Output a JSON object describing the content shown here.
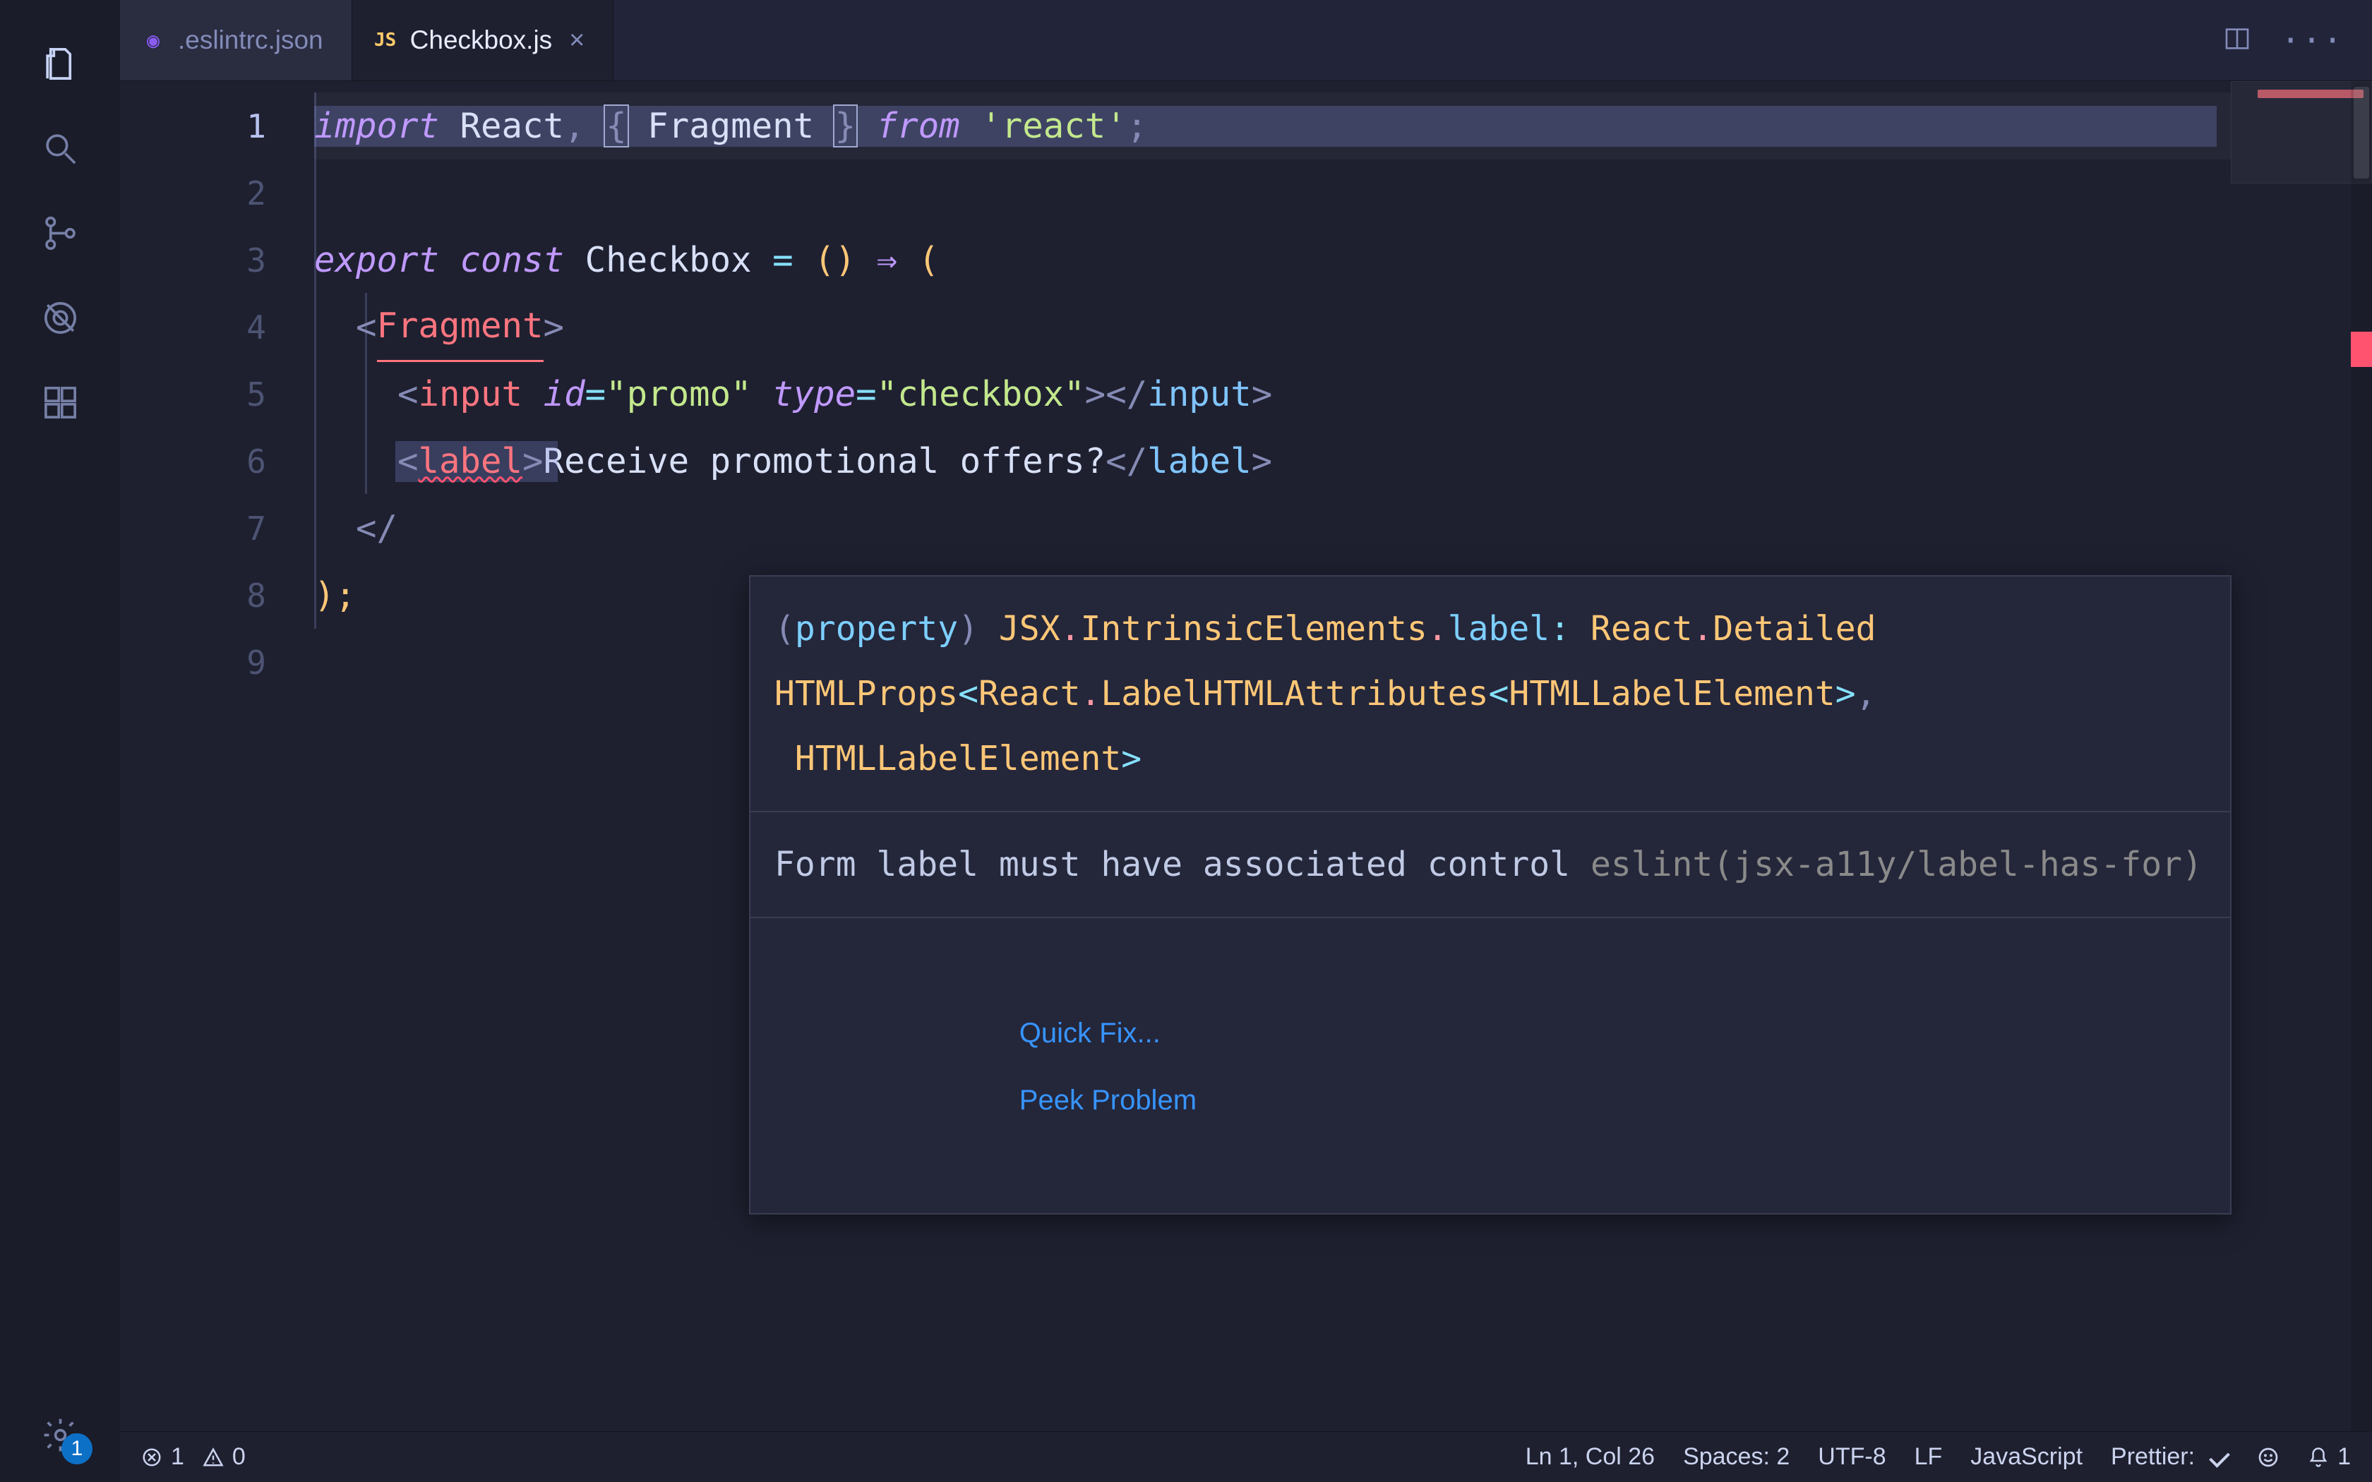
{
  "tabs": {
    "items": [
      {
        "label": ".eslintrc.json",
        "active": false,
        "icon": "eslint-icon",
        "iconColor": "#8b5cf6"
      },
      {
        "label": "Checkbox.js",
        "active": true,
        "icon": "js-icon",
        "iconColor": "#ffcb6b"
      }
    ]
  },
  "editor": {
    "lines": [
      "1",
      "2",
      "3",
      "4",
      "5",
      "6",
      "7",
      "8",
      "9"
    ],
    "code": {
      "l1": {
        "import": "import",
        "react": "React",
        "comma": ",",
        "lbrace": "{",
        "frag": "Fragment",
        "rbrace": "}",
        "from": "from",
        "str": "'react'",
        "semi": ";"
      },
      "l3": {
        "export": "export",
        "const": "const",
        "name": "Checkbox",
        "eq": "=",
        "parens": "()",
        "arrow": "⇒",
        "open": "("
      },
      "l4": {
        "lt": "<",
        "tag": "Fragment",
        "gt": ">"
      },
      "l5": {
        "lt1": "<",
        "tag1": "input",
        "a1n": "id",
        "eq1": "=",
        "a1v": "\"promo\"",
        "a2n": "type",
        "eq2": "=",
        "a2v": "\"checkbox\"",
        "gt1": ">",
        "lts": "</",
        "tag2": "input",
        "gt2": ">"
      },
      "l6": {
        "lt1": "<",
        "tag1": "label",
        "gt1": ">",
        "text": "Receive promotional offers?",
        "lts": "</",
        "tag2": "label",
        "gt2": ">"
      },
      "l7": {
        "lts": "</"
      },
      "l8": {
        "close": ");"
      }
    }
  },
  "hover": {
    "sig_prefix_paren": "(",
    "sig_prefix_kind": "property",
    "sig_prefix_close": ") ",
    "sig_ns1": "JSX",
    "sig_dot1": ".",
    "sig_ns2": "IntrinsicElements",
    "sig_dot2": ".",
    "sig_prop": "label",
    "sig_colon": ": ",
    "sig_ns3": "React",
    "sig_dot3": ".",
    "sig_ty1": "Detailed",
    "sig_ty1b": "HTMLProps",
    "sig_lt1": "<",
    "sig_ns4": "React",
    "sig_dot4": ".",
    "sig_ty2": "LabelHTMLAttributes",
    "sig_lt2": "<",
    "sig_ty3": "HTMLLabelElement",
    "sig_gt2": ">",
    "sig_comma": ",",
    "sig_ty4": " HTMLLabelElement",
    "sig_gt1": ">",
    "msg_text": "Form label must have associated control ",
    "msg_src": "eslint(jsx-a11y/label-has-for)",
    "actions": {
      "quickfix": "Quick Fix...",
      "peek": "Peek Problem"
    }
  },
  "activity": {
    "gear_badge": "1"
  },
  "status": {
    "errors": "1",
    "warnings": "0",
    "lncol": "Ln 1, Col 26",
    "spaces": "Spaces: 2",
    "encoding": "UTF-8",
    "eol": "LF",
    "lang": "JavaScript",
    "prettier": "Prettier:",
    "bell": "1"
  }
}
